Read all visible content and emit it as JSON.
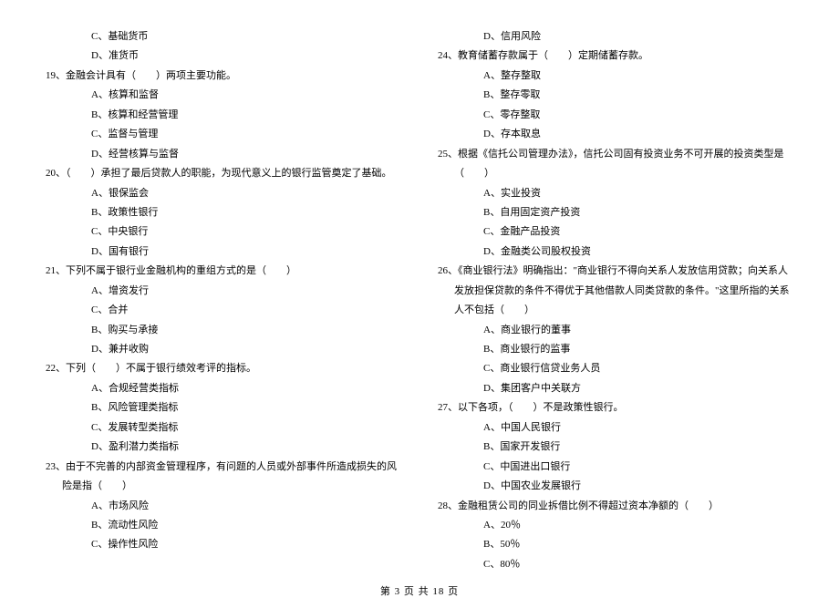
{
  "left": {
    "opt_18_c": "C、基础货币",
    "opt_18_d": "D、准货币",
    "q19": "19、金融会计具有（　　）两项主要功能。",
    "opt_19_a": "A、核算和监督",
    "opt_19_b": "B、核算和经营管理",
    "opt_19_c": "C、监督与管理",
    "opt_19_d": "D、经营核算与监督",
    "q20": "20、（　　）承担了最后贷款人的职能，为现代意义上的银行监管奠定了基础。",
    "opt_20_a": "A、银保监会",
    "opt_20_b": "B、政策性银行",
    "opt_20_c": "C、中央银行",
    "opt_20_d": "D、国有银行",
    "q21": "21、下列不属于银行业金融机构的重组方式的是（　　）",
    "opt_21_a": "A、增资发行",
    "opt_21_b": "C、合并",
    "opt_21_c": "B、购买与承接",
    "opt_21_d": "D、兼并收购",
    "q22": "22、下列（　　）不属于银行绩效考评的指标。",
    "opt_22_a": "A、合规经营类指标",
    "opt_22_b": "B、风险管理类指标",
    "opt_22_c": "C、发展转型类指标",
    "opt_22_d": "D、盈利潜力类指标",
    "q23": "23、由于不完善的内部资金管理程序，有问题的人员或外部事件所造成损失的风险是指（　　）",
    "opt_23_a": "A、市场风险",
    "opt_23_b": "B、流动性风险",
    "opt_23_c": "C、操作性风险"
  },
  "right": {
    "opt_23_d": "D、信用风险",
    "q24": "24、教育储蓄存款属于（　　）定期储蓄存款。",
    "opt_24_a": "A、整存整取",
    "opt_24_b": "B、整存零取",
    "opt_24_c": "C、零存整取",
    "opt_24_d": "D、存本取息",
    "q25": "25、根据《信托公司管理办法》，信托公司固有投资业务不可开展的投资类型是（　　）",
    "opt_25_a": "A、实业投资",
    "opt_25_b": "B、自用固定资产投资",
    "opt_25_c": "C、金融产品投资",
    "opt_25_d": "D、金融类公司股权投资",
    "q26": "26、《商业银行法》明确指出：\"商业银行不得向关系人发放信用贷款；向关系人发放担保贷款的条件不得优于其他借款人同类贷款的条件。\"这里所指的关系人不包括（　　）",
    "opt_26_a": "A、商业银行的董事",
    "opt_26_b": "B、商业银行的监事",
    "opt_26_c": "C、商业银行信贷业务人员",
    "opt_26_d": "D、集团客户中关联方",
    "q27": "27、以下各项，（　　）不是政策性银行。",
    "opt_27_a": "A、中国人民银行",
    "opt_27_b": "B、国家开发银行",
    "opt_27_c": "C、中国进出口银行",
    "opt_27_d": "D、中国农业发展银行",
    "q28": "28、金融租赁公司的同业拆借比例不得超过资本净额的（　　）",
    "opt_28_a": "A、20％",
    "opt_28_b": "B、50％",
    "opt_28_c": "C、80％"
  },
  "footer": "第 3 页 共 18 页"
}
